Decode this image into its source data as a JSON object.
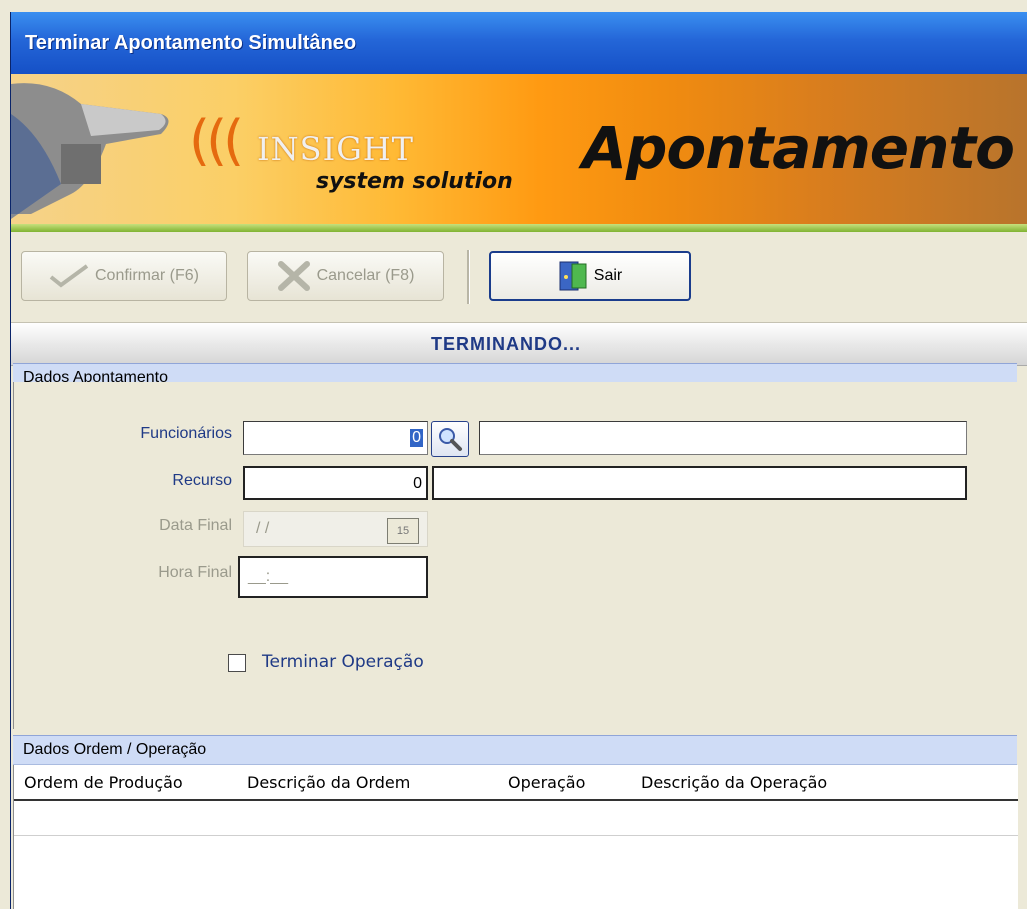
{
  "window": {
    "title": "Terminar Apontamento Simultâneo"
  },
  "banner": {
    "logo_name": "INSIGHT",
    "logo_sub": "system solution",
    "module_title": "Apontamento"
  },
  "toolbar": {
    "confirm_label": "Confirmar (F6)",
    "cancel_label": "Cancelar (F8)",
    "exit_label": "Sair"
  },
  "status": {
    "text": "TERMINANDO..."
  },
  "dados_apontamento": {
    "title": "Dados Apontamento",
    "funcionarios": {
      "label": "Funcionários",
      "code": "0",
      "name": ""
    },
    "recurso": {
      "label": "Recurso",
      "code": "0",
      "name": ""
    },
    "data_final": {
      "label": "Data Final",
      "value": "/ /",
      "calendar_text": "15"
    },
    "hora_final": {
      "label": "Hora Final",
      "value": "__:__"
    },
    "terminar_operacao": {
      "label": "Terminar Operação",
      "checked": false
    }
  },
  "dados_ordem": {
    "title": "Dados Ordem / Operação",
    "columns": [
      "Ordem de Produção",
      "Descrição da Ordem",
      "Operação",
      "Descrição da Operação"
    ],
    "rows": []
  },
  "icons": {
    "confirm": "check-icon",
    "cancel": "x-icon",
    "exit": "door-icon",
    "lookup": "magnifier-icon",
    "calendar": "calendar-icon"
  },
  "colors": {
    "title_bar": "#2466d8",
    "accent_text": "#1f3a86",
    "banner_orange": "#ff9a12",
    "group_header": "#cfdcf6"
  }
}
